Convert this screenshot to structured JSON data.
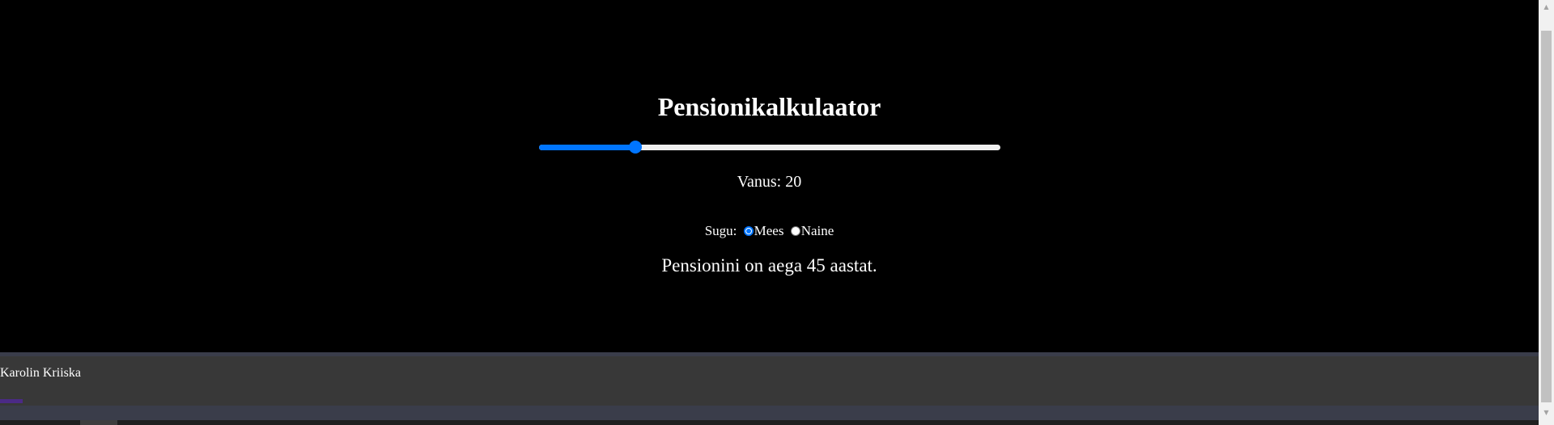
{
  "page": {
    "title": "Pensionikalkulaator"
  },
  "age_slider": {
    "min": 0,
    "max": 100,
    "value": 20,
    "fill_color": "#0075ff",
    "track_color": "#efefef"
  },
  "age": {
    "label": "Vanus:",
    "value": "20"
  },
  "gender": {
    "label": "Sugu:",
    "options": [
      {
        "label": "Mees",
        "checked": true
      },
      {
        "label": "Naine",
        "checked": false
      }
    ]
  },
  "result": {
    "text": "Pensionini on aega 45 aastat."
  },
  "footer": {
    "author": "Karolin Kriiska"
  },
  "scrollbar": {
    "up_icon": "triangle-up-icon",
    "down_icon": "triangle-down-icon"
  }
}
